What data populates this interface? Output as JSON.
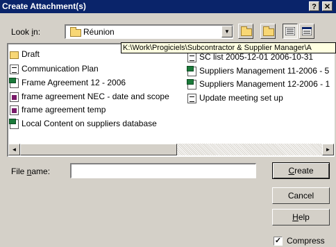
{
  "window": {
    "title": "Create Attachment(s)",
    "help_button": "?",
    "close_button": "✕"
  },
  "look_in": {
    "label_prefix": "Look ",
    "label_accel": "i",
    "label_suffix": "n:",
    "value": "Réunion",
    "dropdown_arrow": "▼"
  },
  "toolbar": {
    "up_icon": "up-folder-icon",
    "new_folder_icon": "new-folder-icon",
    "list_view_icon": "list-view-icon",
    "details_view_icon": "details-view-icon"
  },
  "files": [
    {
      "name": "Draft",
      "icon": "folder-icon"
    },
    {
      "name": "Communication Plan",
      "icon": "word-document-icon"
    },
    {
      "name": "Frame Agreement 12 - 2006",
      "icon": "project-file-icon"
    },
    {
      "name": "frame agreement NEC - date and scope",
      "icon": "image-document-icon"
    },
    {
      "name": "frame agreement temp",
      "icon": "image-document-icon"
    },
    {
      "name": "Local Content on suppliers database",
      "icon": "project-file-icon"
    },
    {
      "name": "SC list 2005-12-01 2006-10-31",
      "icon": "word-document-icon"
    },
    {
      "name": "Suppliers Management 11-2006 - 5",
      "icon": "project-file-icon"
    },
    {
      "name": "Suppliers Management 12-2006 - 1",
      "icon": "project-file-icon"
    },
    {
      "name": "Update meeting set up",
      "icon": "word-document-icon"
    }
  ],
  "tooltip": "K:\\Work\\Progiciels\\Subcontractor & Supplier Manager\\A",
  "file_name": {
    "label_prefix": "File ",
    "label_accel": "n",
    "label_suffix": "ame:",
    "value": ""
  },
  "buttons": {
    "create": {
      "accel": "C",
      "rest": "reate"
    },
    "cancel": {
      "label": "Cancel"
    },
    "help": {
      "accel": "H",
      "rest": "elp"
    }
  },
  "compress": {
    "label": "Compress",
    "checked": true,
    "check_mark": "✓"
  },
  "scrollbar": {
    "left_arrow": "◄",
    "right_arrow": "►"
  },
  "colors": {
    "titlebar": "#0a246a",
    "face": "#d4d0c8",
    "tooltip_bg": "#ffffe1"
  }
}
